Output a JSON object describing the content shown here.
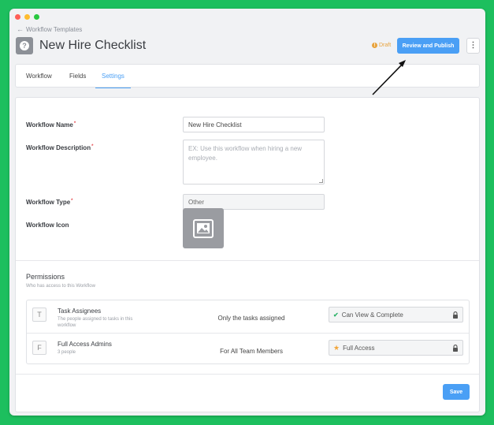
{
  "nav": {
    "back_label": "Workflow Templates"
  },
  "header": {
    "title": "New Hire Checklist",
    "status": "Draft",
    "publish_label": "Review and Publish"
  },
  "tabs": [
    {
      "label": "Workflow",
      "active": false
    },
    {
      "label": "Fields",
      "active": false
    },
    {
      "label": "Settings",
      "active": true
    }
  ],
  "form": {
    "name_label": "Workflow Name",
    "name_value": "New Hire Checklist",
    "description_label": "Workflow Description",
    "description_placeholder": "EX: Use this workflow when hiring a new employee.",
    "type_label": "Workflow Type",
    "type_value": "Other",
    "icon_label": "Workflow Icon"
  },
  "permissions": {
    "title": "Permissions",
    "subtitle": "Who has access to this Workflow",
    "rows": [
      {
        "letter": "T",
        "name": "Task Assignees",
        "description": "The people assigned to tasks in this workflow",
        "scope": "Only the tasks assigned",
        "access": "Can View & Complete",
        "access_icon": "check-icon"
      },
      {
        "letter": "F",
        "name": "Full Access Admins",
        "description": "3 people",
        "scope": "For All Team Members",
        "access": "Full Access",
        "access_icon": "star-icon"
      }
    ]
  },
  "footer": {
    "save_label": "Save"
  },
  "colors": {
    "accent": "#4a9ff5",
    "background": "#1dbf5e",
    "draft": "#e8a33d",
    "check": "#2fb36a",
    "star": "#f2a53a"
  }
}
